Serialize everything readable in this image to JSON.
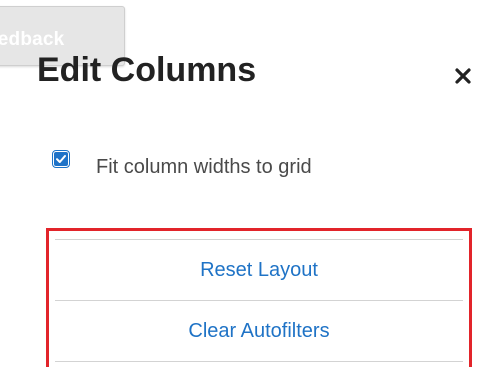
{
  "feedback": {
    "label": "eedback"
  },
  "dialog": {
    "title": "Edit Columns",
    "close_icon": "close-icon"
  },
  "options": {
    "fit_columns": {
      "label": "Fit column widths to grid",
      "checked": true
    }
  },
  "actions": {
    "reset_layout": "Reset Layout",
    "clear_autofilters": "Clear Autofilters"
  },
  "colors": {
    "accent": "#1f73c6",
    "highlight_border": "#e2242a",
    "title": "#222222"
  }
}
